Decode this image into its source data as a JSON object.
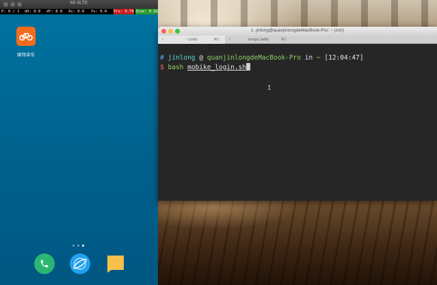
{
  "emulator": {
    "window_title": "MI 4LTE",
    "pointer_location": {
      "p": "P: 0 / 1",
      "dx": "dX: 0.0",
      "dy": "dY: 0.0",
      "xv": "Xv: 0.0",
      "yv": "Yv: 0.0",
      "prs": "Prs: 0.76",
      "size": "Size: 0.02"
    },
    "home": {
      "app_label": "摩拜单车",
      "app_icon": "bike-icon",
      "page_indicator": {
        "count": 3,
        "active_index": 2
      },
      "dock": [
        {
          "name": "phone",
          "icon": "phone-icon"
        },
        {
          "name": "browser",
          "icon": "browser-icon"
        },
        {
          "name": "messages",
          "icon": "message-icon"
        }
      ]
    }
  },
  "terminal": {
    "window_title": "1. jinlong@quanjinlongdeMacBook-Pro: ~ (zsh)",
    "tabs": [
      {
        "close": "×",
        "label": "~ (zsh)",
        "shortcut": "⌘1",
        "active": true
      },
      {
        "close": "×",
        "label": "scrcpy (adb)",
        "shortcut": "⌘2",
        "active": false
      }
    ],
    "prompt": {
      "hash": "#",
      "user": "jinlong",
      "at": "@",
      "host": "quanjinlongdeMacBook-Pro",
      "in": "in",
      "dir": "~",
      "time": "[12:04:47]"
    },
    "command": {
      "dollar": "$",
      "cmd": "bash",
      "arg": "mobike_login.sh"
    }
  },
  "colors": {
    "phone_bg": "#00638f",
    "terminal_bg": "#262626",
    "app_icon_bg": "#f36c1d",
    "prompt_blue": "#5aa9f5",
    "prompt_green": "#8fd16a",
    "prompt_yellow": "#e4c24f",
    "prompt_red": "#f46a6a"
  }
}
